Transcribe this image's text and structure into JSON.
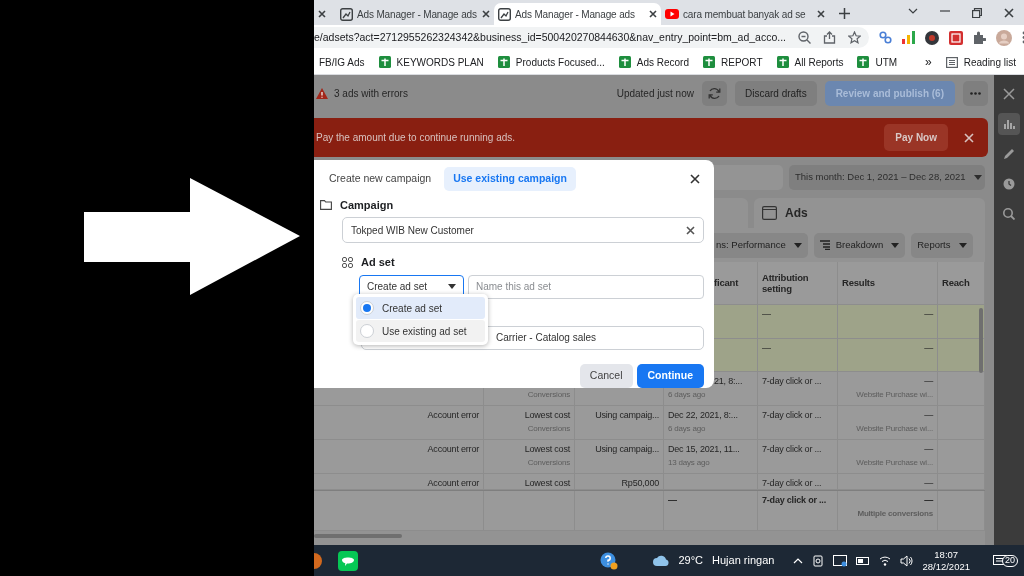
{
  "browser": {
    "tabs": [
      {
        "title": "Ads Manager - Manage ads",
        "kind": "ads",
        "selected": false
      },
      {
        "title": "Ads Manager - Manage ads",
        "kind": "ads",
        "selected": true
      },
      {
        "title": "cara membuat banyak ad se",
        "kind": "video",
        "selected": false
      }
    ],
    "url": "e/adsets?act=2712955262324342&business_id=500420270844630&nav_entry_point=bm_ad_acco...",
    "bookmarks": [
      {
        "label": "FB/IG Ads",
        "kind": "plain"
      },
      {
        "label": "KEYWORDS PLAN",
        "kind": "sheet"
      },
      {
        "label": "Products Focused...",
        "kind": "sheet"
      },
      {
        "label": "Ads Record",
        "kind": "sheet"
      },
      {
        "label": "REPORT",
        "kind": "sheet"
      },
      {
        "label": "All Reports",
        "kind": "sheet"
      },
      {
        "label": "UTM",
        "kind": "sheet"
      }
    ],
    "overflow": "»",
    "reading_list": "Reading list"
  },
  "app": {
    "errors": "3 ads with errors",
    "updated": "Updated just now",
    "discard": "Discard drafts",
    "publish": "Review and publish (6)",
    "banner": {
      "message": "Pay the amount due to continue running ads.",
      "action": "Pay Now"
    },
    "date_range": "This month: Dec 1, 2021 – Dec 28, 2021",
    "ads_tab": "Ads",
    "toolbar": [
      "ns: Performance",
      "Breakdown",
      "Reports"
    ],
    "table": {
      "columns": [
        {
          "label": "ficant",
          "covered_left": true
        },
        {
          "label": "Attribution setting"
        },
        {
          "label": "Results"
        },
        {
          "label": "Reach"
        }
      ],
      "rows": [
        {
          "highlighted": true,
          "cells": {
            "attribution_setting": "—",
            "results": "—"
          }
        },
        {
          "highlighted": true,
          "cells": {
            "attribution_setting": "—",
            "results": "—"
          }
        },
        {
          "highlighted": false,
          "cells": {
            "column_2": {
              "sub": "Conversions"
            },
            "column_4": {
              "main": "21, 8:...",
              "sub": "6 days ago",
              "covered_left": true
            },
            "attribution_setting": "7-day click or ...",
            "results": {
              "main": "—",
              "sub": "Website Purchase wi..."
            }
          }
        },
        {
          "highlighted": false,
          "cells": {
            "column_1": "Account error",
            "column_2": {
              "main": "Lowest cost",
              "sub": "Conversions"
            },
            "column_3": "Using campaig...",
            "column_4": {
              "main": "Dec 22, 2021, 8:...",
              "sub": "6 days ago"
            },
            "attribution_setting": "7-day click or ...",
            "results": {
              "main": "—",
              "sub": "Website Purchase wi..."
            }
          }
        },
        {
          "highlighted": false,
          "cells": {
            "column_1": "Account error",
            "column_2": {
              "main": "Lowest cost",
              "sub": "Conversions"
            },
            "column_3": "Using campaig...",
            "column_4": {
              "main": "Dec 15, 2021, 11...",
              "sub": "13 days ago"
            },
            "attribution_setting": "7-day click or ...",
            "results": {
              "main": "—",
              "sub": "Website Purchase wi..."
            }
          }
        },
        {
          "highlighted": false,
          "cells": {
            "column_1": "Account error",
            "column_2": "Lowest cost",
            "column_3": "Rp50,000",
            "attribution_setting": "7-day click or ...",
            "results": "—"
          }
        }
      ],
      "total": {
        "column_4": "—",
        "attribution_setting": "7-day click or ...",
        "results": {
          "main": "—",
          "sub": "Multiple conversions"
        }
      }
    },
    "side_tools": [
      {
        "kind": "close",
        "selected": false
      },
      {
        "kind": "chart",
        "selected": true
      },
      {
        "kind": "edit",
        "selected": false
      },
      {
        "kind": "history",
        "selected": false
      },
      {
        "kind": "zoom",
        "selected": false
      }
    ]
  },
  "dialog": {
    "tabs": [
      {
        "label": "Create new campaign",
        "selected": false
      },
      {
        "label": "Use existing campaign",
        "selected": true
      }
    ],
    "campaign_label": "Campaign",
    "campaign_value": "Tokped WIB New Customer",
    "adset_label": "Ad set",
    "adset_mode": "Create ad set",
    "adset_name_placeholder": "Name this ad set",
    "menu": [
      {
        "label": "Create ad set",
        "selected": true
      },
      {
        "label": "Use existing ad set",
        "selected": false
      }
    ],
    "covered_field_value": "Carrier - Catalog sales",
    "cancel": "Cancel",
    "continue": "Continue"
  },
  "taskbar": {
    "temperature": "29°C",
    "weather": "Hujan ringan",
    "time": "18:07",
    "date": "28/12/2021",
    "notifications": "20"
  }
}
